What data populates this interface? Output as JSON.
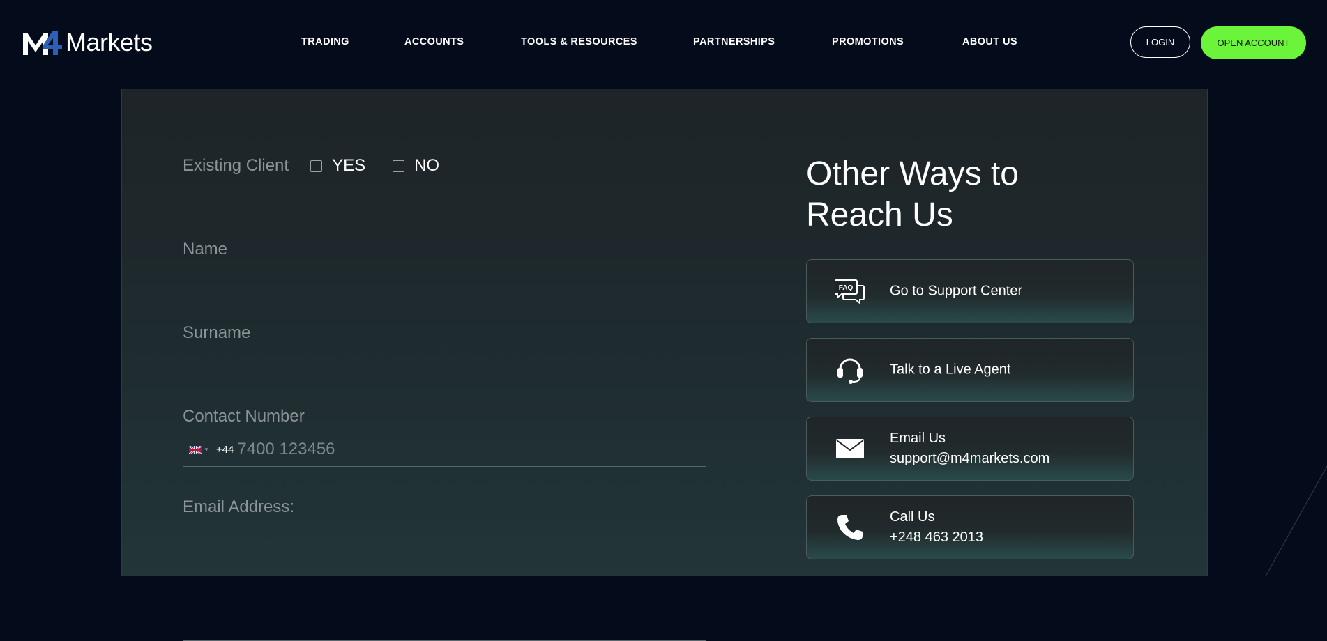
{
  "header": {
    "logo_mark": "M4",
    "logo_text": "Markets",
    "nav": [
      "TRADING",
      "ACCOUNTS",
      "TOOLS & RESOURCES",
      "PARTNERSHIPS",
      "PROMOTIONS",
      "ABOUT US"
    ],
    "login_label": "LOGIN",
    "open_account_label": "OPEN ACCOUNT"
  },
  "form": {
    "existing_client_label": "Existing Client",
    "yes_label": "YES",
    "no_label": "NO",
    "name_label": "Name",
    "surname_label": "Surname",
    "contact_label": "Contact Number",
    "dial_code": "+44",
    "phone_placeholder": "7400 123456",
    "email_label": "Email Address:"
  },
  "contact": {
    "title": "Other Ways to Reach Us",
    "faq_icon_text": "FAQ",
    "support_center": "Go to Support Center",
    "live_agent": "Talk to a Live Agent",
    "email_title": "Email Us",
    "email_address": "support@m4markets.com",
    "call_title": "Call Us",
    "phone_number": "+248 463 2013"
  },
  "colors": {
    "background": "#040b1b",
    "accent_green": "#6cf43b",
    "logo_blue": "#2e5fb8"
  }
}
